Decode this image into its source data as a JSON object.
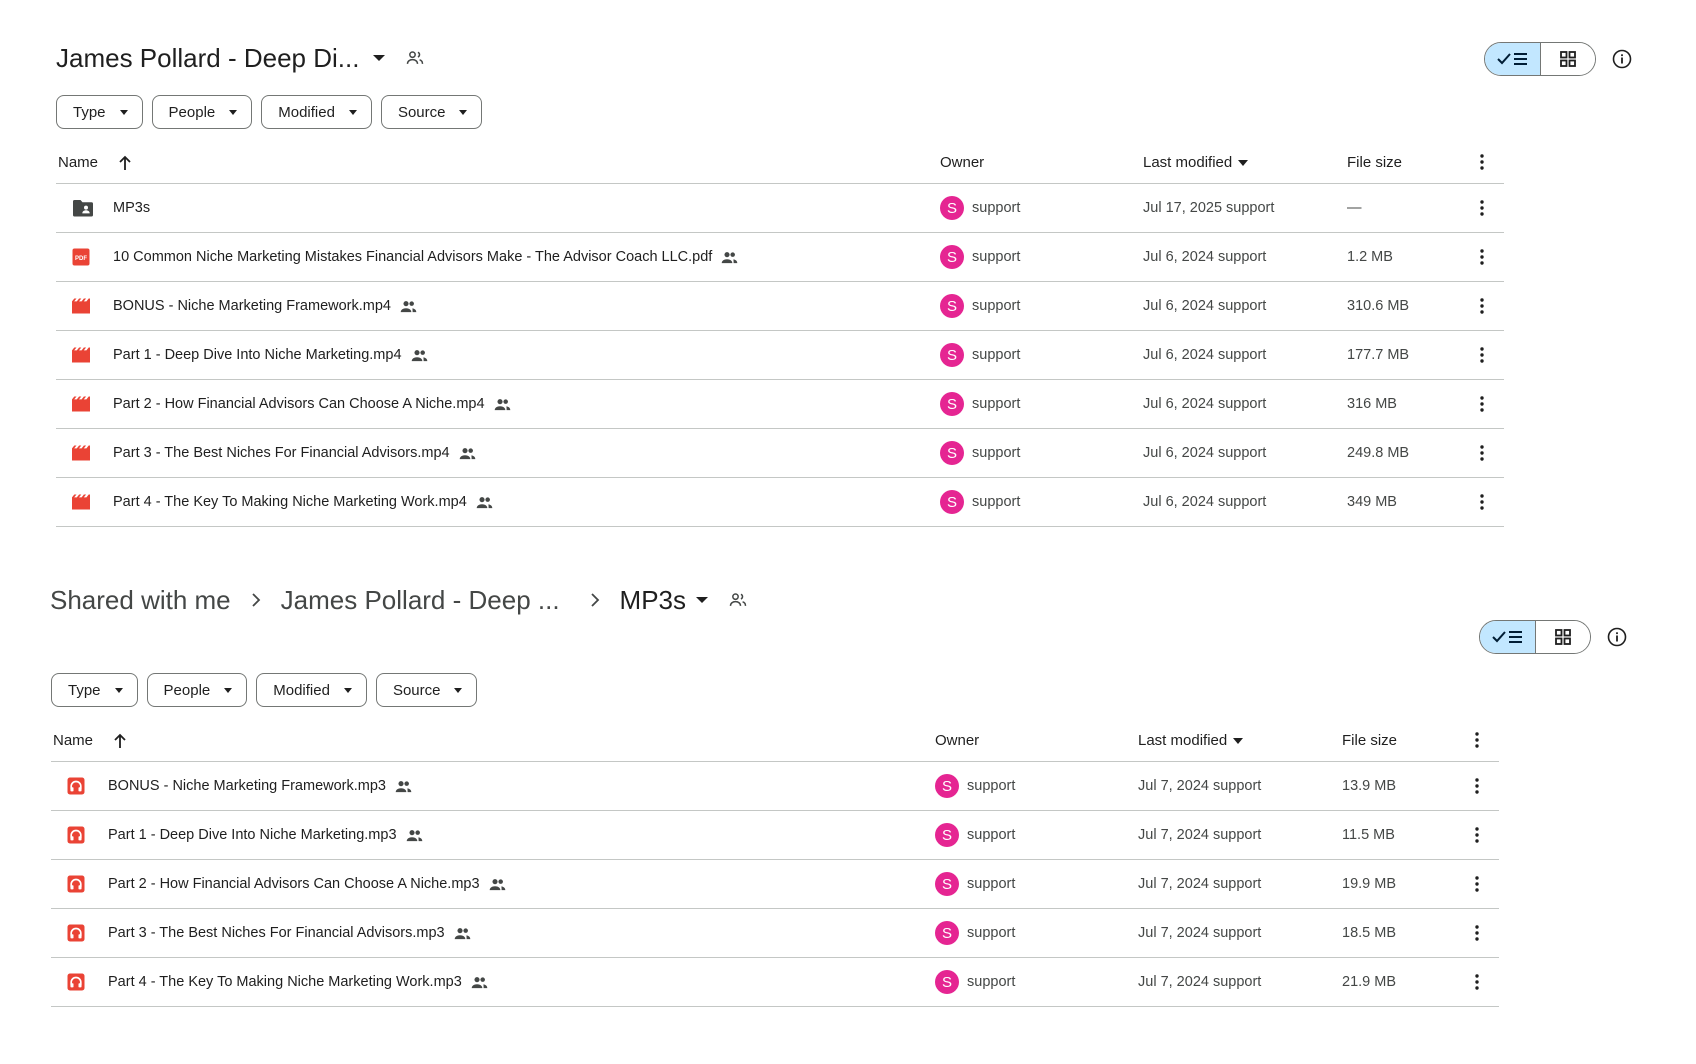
{
  "panel1": {
    "title": "James Pollard - Deep Di...",
    "filters": [
      "Type",
      "People",
      "Modified",
      "Source"
    ],
    "columns": {
      "name": "Name",
      "owner": "Owner",
      "modified": "Last modified",
      "size": "File size"
    },
    "rows": [
      {
        "icon": "shared-folder-icon",
        "name": "MP3s",
        "shared": false,
        "owner": "support",
        "avatar": "S",
        "modified": "Jul 17, 2025 support",
        "size": "—"
      },
      {
        "icon": "pdf-icon",
        "name": "10 Common Niche Marketing Mistakes Financial Advisors Make - The Advisor Coach LLC.pdf",
        "shared": true,
        "owner": "support",
        "avatar": "S",
        "modified": "Jul 6, 2024 support",
        "size": "1.2 MB"
      },
      {
        "icon": "video-icon",
        "name": "BONUS - Niche Marketing Framework.mp4",
        "shared": true,
        "owner": "support",
        "avatar": "S",
        "modified": "Jul 6, 2024 support",
        "size": "310.6 MB"
      },
      {
        "icon": "video-icon",
        "name": "Part 1 - Deep Dive Into Niche Marketing.mp4",
        "shared": true,
        "owner": "support",
        "avatar": "S",
        "modified": "Jul 6, 2024 support",
        "size": "177.7 MB"
      },
      {
        "icon": "video-icon",
        "name": "Part 2 - How Financial Advisors Can Choose A Niche.mp4",
        "shared": true,
        "owner": "support",
        "avatar": "S",
        "modified": "Jul 6, 2024 support",
        "size": "316 MB"
      },
      {
        "icon": "video-icon",
        "name": "Part 3 - The Best Niches For Financial Advisors.mp4",
        "shared": true,
        "owner": "support",
        "avatar": "S",
        "modified": "Jul 6, 2024 support",
        "size": "249.8 MB"
      },
      {
        "icon": "video-icon",
        "name": "Part 4 - The Key To Making Niche Marketing Work.mp4",
        "shared": true,
        "owner": "support",
        "avatar": "S",
        "modified": "Jul 6, 2024 support",
        "size": "349 MB"
      }
    ]
  },
  "panel2": {
    "breadcrumb": [
      "Shared with me",
      "James Pollard - Deep ...",
      "MP3s"
    ],
    "filters": [
      "Type",
      "People",
      "Modified",
      "Source"
    ],
    "columns": {
      "name": "Name",
      "owner": "Owner",
      "modified": "Last modified",
      "size": "File size"
    },
    "rows": [
      {
        "icon": "audio-icon",
        "name": "BONUS - Niche Marketing Framework.mp3",
        "shared": true,
        "owner": "support",
        "avatar": "S",
        "modified": "Jul 7, 2024 support",
        "size": "13.9 MB"
      },
      {
        "icon": "audio-icon",
        "name": "Part 1 - Deep Dive Into Niche Marketing.mp3",
        "shared": true,
        "owner": "support",
        "avatar": "S",
        "modified": "Jul 7, 2024 support",
        "size": "11.5 MB"
      },
      {
        "icon": "audio-icon",
        "name": "Part 2 - How Financial Advisors Can Choose A Niche.mp3",
        "shared": true,
        "owner": "support",
        "avatar": "S",
        "modified": "Jul 7, 2024 support",
        "size": "19.9 MB"
      },
      {
        "icon": "audio-icon",
        "name": "Part 3 - The Best Niches For Financial Advisors.mp3",
        "shared": true,
        "owner": "support",
        "avatar": "S",
        "modified": "Jul 7, 2024 support",
        "size": "18.5 MB"
      },
      {
        "icon": "audio-icon",
        "name": "Part 4 - The Key To Making Niche Marketing Work.mp3",
        "shared": true,
        "owner": "support",
        "avatar": "S",
        "modified": "Jul 7, 2024 support",
        "size": "21.9 MB"
      }
    ]
  },
  "colors": {
    "accent_toggle": "#c2e7ff",
    "avatar": "#e52592",
    "file_red": "#ea4335",
    "folder": "#444746"
  }
}
